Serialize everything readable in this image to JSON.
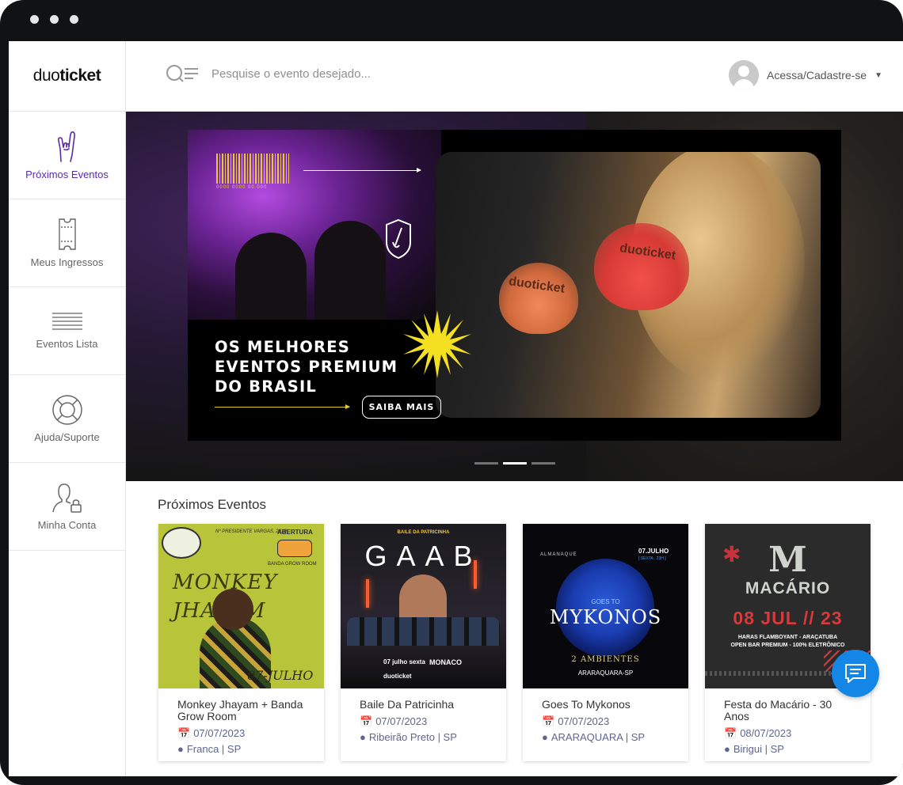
{
  "app": {
    "logo_prefix": "duo",
    "logo_suffix": "ticket"
  },
  "sidebar": {
    "items": [
      {
        "label": "Próximos Eventos",
        "icon": "rock-hand-icon",
        "active": true
      },
      {
        "label": "Meus Ingressos",
        "icon": "ticket-icon",
        "active": false
      },
      {
        "label": "Eventos Lista",
        "icon": "list-icon",
        "active": false
      },
      {
        "label": "Ajuda/Suporte",
        "icon": "lifebuoy-icon",
        "active": false
      },
      {
        "label": "Minha Conta",
        "icon": "user-lock-icon",
        "active": false
      }
    ]
  },
  "search": {
    "placeholder": "Pesquise o evento desejado..."
  },
  "account": {
    "label": "Acessa/Cadastre-se"
  },
  "hero": {
    "headline": [
      "OS MELHORES",
      "EVENTOS PREMIUM",
      "DO BRASIL"
    ],
    "cta": "SAIBA MAIS",
    "glass_text": "duoticket",
    "barcode_digits": "0000 0000 00 000",
    "slides": 3,
    "active_slide": 2
  },
  "events": {
    "title": "Próximos Eventos",
    "cards": [
      {
        "title": "Monkey Jhayam + Banda Grow Room",
        "date": "07/07/2023",
        "location": "Franca | SP",
        "poster": {
          "top_left": "Nº PRESIDENTE VARGAS, 2210",
          "top_right": "ABERTURA",
          "sub": "BANDA GROW ROOM",
          "main": "MONKEY JHAYAM",
          "date": "07-JULHO"
        }
      },
      {
        "title": "Baile Da Patricinha",
        "date": "07/07/2023",
        "location": "Ribeirão Preto | SP",
        "poster": {
          "header": "BAILE DA PATRICINHA",
          "main": "GAAB",
          "date": "07 julho sexta",
          "venue": "MONACO",
          "brand": "duoticket"
        }
      },
      {
        "title": "Goes To Mykonos",
        "date": "07/07/2023",
        "location": "ARARAQUARA | SP",
        "poster": {
          "brand": "ALMANAQUE",
          "date": "07.JULHO",
          "day": "[ SEXTA . 23H ]",
          "small": "GOES TO",
          "main": "MYKONOS",
          "sub": "2 AMBIENTES",
          "city": "ARARAQUARA-SP"
        }
      },
      {
        "title": "Festa do Macário - 30 Anos",
        "date": "08/07/2023",
        "location": "Birigui | SP",
        "poster": {
          "letter": "M",
          "main": "MACÁRIO",
          "date": "08 JUL // 23",
          "line1": "HARAS FLAMBOYANT - ARAÇATUBA",
          "line2": "OPEN BAR PREMIUM - 100% ELETRÔNICO"
        }
      }
    ]
  },
  "colors": {
    "accent": "#5b2aa8",
    "chat": "#1487e6",
    "meta": "#5d6690"
  }
}
